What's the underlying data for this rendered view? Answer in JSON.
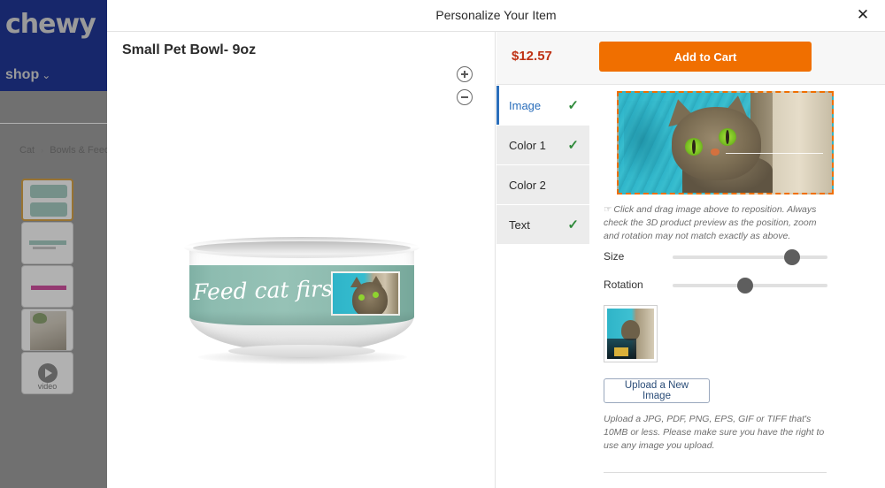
{
  "background_site": {
    "logo": "chewy",
    "shop_label": "shop",
    "chevron": "⌄",
    "breadcrumb": [
      {
        "label": "Cat"
      },
      {
        "label": "Bowls & Feed"
      }
    ],
    "breadcrumb_separator": "›",
    "thumbnails": [
      {
        "name": "thumbnail-bowl-front",
        "selected": true,
        "caption": ""
      },
      {
        "name": "thumbnail-bowl-side",
        "selected": false,
        "caption": ""
      },
      {
        "name": "thumbnail-bowl-pink",
        "selected": false,
        "caption": ""
      },
      {
        "name": "thumbnail-lifestyle",
        "selected": false,
        "caption": ""
      },
      {
        "name": "thumbnail-video",
        "selected": false,
        "caption": "video"
      }
    ]
  },
  "modal": {
    "title": "Personalize Your Item",
    "close_label": "✕"
  },
  "preview": {
    "product_name": "Small Pet Bowl- 9oz",
    "zoom_in_label": "+",
    "zoom_out_label": "−",
    "bowl_text": "Feed cat first"
  },
  "options": {
    "price": "$12.57",
    "add_to_cart_label": "Add to Cart",
    "tabs": [
      {
        "label": "Image",
        "active": true,
        "complete": true,
        "check": "✓"
      },
      {
        "label": "Color 1",
        "active": false,
        "complete": true,
        "check": "✓"
      },
      {
        "label": "Color 2",
        "active": false,
        "complete": false,
        "check": ""
      },
      {
        "label": "Text",
        "active": false,
        "complete": true,
        "check": "✓"
      }
    ],
    "hint_icon": "☞",
    "hint_text": "Click and drag image above to reposition. Always check the 3D product preview as the position, zoom and rotation may not match exactly as above.",
    "sliders": [
      {
        "label": "Size",
        "value_percent": 77
      },
      {
        "label": "Rotation",
        "value_percent": 47
      }
    ],
    "upload_button_label": "Upload a New Image",
    "upload_note": "Upload a JPG, PDF, PNG, EPS, GIF or TIFF that's 10MB or less. Please make sure you have the right to use any image you upload."
  },
  "colors": {
    "brand_navy": "#17276b",
    "accent_orange": "#f06f00",
    "price_red": "#bf3215",
    "tab_active_blue": "#2a6ebb",
    "check_green": "#2f8a3a",
    "dashed_border": "#f06f00",
    "bowl_band": "#8dbcb0",
    "selected_thumb_border": "#d08b10"
  }
}
